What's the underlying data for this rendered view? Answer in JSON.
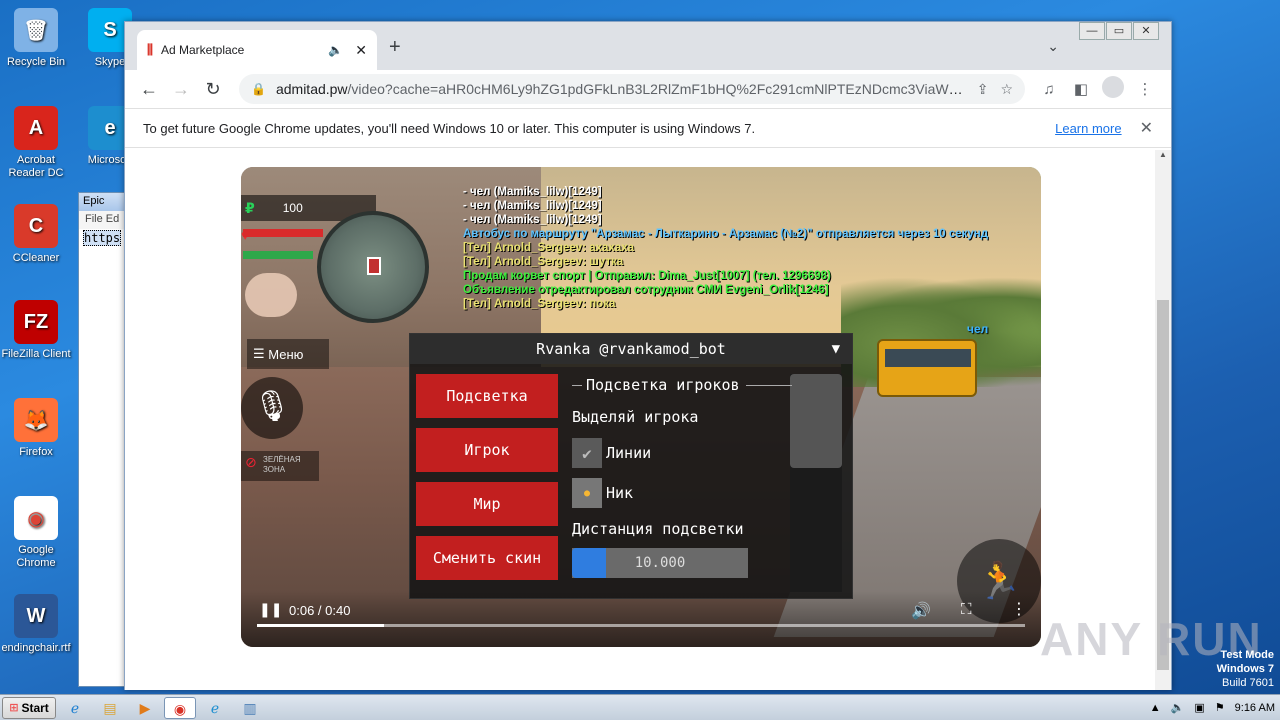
{
  "desktop": {
    "icons": [
      {
        "label": "Recycle Bin",
        "icon": "recycle-bin-icon",
        "color": "#7fb2e6",
        "glyph": "🗑"
      },
      {
        "label": "Skype",
        "icon": "skype-icon",
        "color": "#00aff0",
        "glyph": "S"
      },
      {
        "label": "Acrobat Reader DC",
        "icon": "acrobat-icon",
        "color": "#d9251c",
        "glyph": "A"
      },
      {
        "label": "Microsoft",
        "icon": "edge-icon",
        "color": "#1d8ecf",
        "glyph": "e"
      },
      {
        "label": "CCleaner",
        "icon": "ccleaner-icon",
        "color": "#d93a2a",
        "glyph": "C"
      },
      {
        "label": "FileZilla Client",
        "icon": "filezilla-icon",
        "color": "#bf0000",
        "glyph": "FZ"
      },
      {
        "label": "Firefox",
        "icon": "firefox-icon",
        "color": "#ff7139",
        "glyph": "🦊"
      },
      {
        "label": "Google Chrome",
        "icon": "chrome-icon",
        "color": "#ffffff",
        "glyph": "◉"
      },
      {
        "label": "endingchair.rtf",
        "icon": "word-doc-icon",
        "color": "#2b5797",
        "glyph": "W"
      }
    ]
  },
  "notepad": {
    "title": "Epic",
    "menu": "File  Ed",
    "text": "https"
  },
  "browser": {
    "tab_title": "Ad Marketplace",
    "url_domain": "admitad.pw",
    "url_rest": "/video?cache=aHR0cHM6Ly9hZG1pdGFkLnB3L2RlZmF1bHQ%2Fc291cmNlPTEzNDcmc3ViaWQ9TF...",
    "infobar_message": "To get future Google Chrome updates, you'll need Windows 10 or later. This computer is using Windows 7.",
    "infobar_link": "Learn more"
  },
  "video": {
    "time": "0:06 / 0:40",
    "progress_fraction": 0.165,
    "hud": {
      "money": "100",
      "menu_label": "Меню",
      "green_zone": "ЗЕЛЁНАЯ ЗОНА",
      "bus_label": "чел"
    },
    "chat": [
      {
        "text": "- чел (Mamiks_lilw)[1249]",
        "color": "#ffffff"
      },
      {
        "text": "- чел (Mamiks_lilw)[1249]",
        "color": "#ffffff"
      },
      {
        "text": "- чел (Mamiks_lilw)[1249]",
        "color": "#ffffff"
      },
      {
        "text": "Автобус по маршруту \"Арзамас - Лыткарино - Арзамас (№2)\" отправляется через 10 секунд",
        "color": "#5ec3ff"
      },
      {
        "text": "[Тел] Arnold_Sergeev: ахахаха",
        "color": "#e8e070"
      },
      {
        "text": "[Тел] Arnold_Sergeev: шутка",
        "color": "#e8e070"
      },
      {
        "text": "Продам корвет спорт | Отправил: Dima_Just[1007] (тел. 1296698)",
        "color": "#3ef03e"
      },
      {
        "text": "Объявление отредактировал сотрудник СМИ Evgeni_Orlik[1246]",
        "color": "#3ef03e"
      },
      {
        "text": "[Тел] Arnold_Sergeev: пока",
        "color": "#e8e070"
      }
    ],
    "mod_menu": {
      "title": "Rvanka @rvankamod_bot",
      "buttons": [
        "Подсветка",
        "Игрок",
        "Мир",
        "Сменить скин"
      ],
      "section": "Подсветка игроков",
      "option_label": "Выделяй игрока",
      "checkbox_lines": "Линии",
      "checkbox_nick": "Ник",
      "distance_label": "Дистанция подсветки",
      "distance_value": "10.000"
    }
  },
  "watermark": "ANY RUN",
  "testmode": {
    "line1": "Test Mode",
    "line2": "Windows 7",
    "line3": "Build 7601"
  },
  "taskbar": {
    "start_label": "Start",
    "clock": "9:16 AM"
  }
}
